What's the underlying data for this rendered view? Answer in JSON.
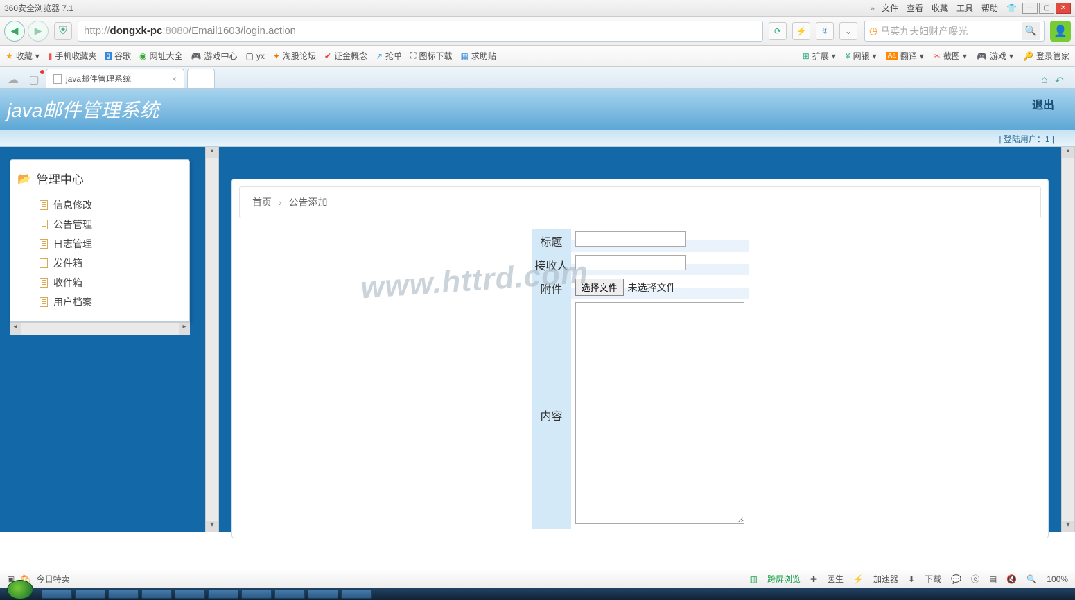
{
  "browser": {
    "title": "360安全浏览器 7.1",
    "menus": [
      "文件",
      "查看",
      "收藏",
      "工具",
      "帮助"
    ],
    "url_proto": "http://",
    "url_host": "dongxk-pc",
    "url_port": ":8080",
    "url_path": "/Email1603/login.action",
    "search_placeholder": "马英九夫妇财产曝光"
  },
  "bookmarks": {
    "fav_label": "收藏",
    "items": [
      "手机收藏夹",
      "谷歌",
      "网址大全",
      "游戏中心",
      "yx",
      "淘股论坛",
      "证金概念",
      "抢单",
      "图标下载",
      "求助贴"
    ],
    "right_items": [
      "扩展",
      "网银",
      "翻译",
      "截图",
      "游戏",
      "登录管家"
    ]
  },
  "tab": {
    "title": "java邮件管理系统"
  },
  "app": {
    "banner_title": "java邮件管理系统",
    "logout": "退出",
    "user_line": "| 登陆用户：1 |"
  },
  "sidebar": {
    "title": "管理中心",
    "items": [
      "信息修改",
      "公告管理",
      "日志管理",
      "发件箱",
      "收件箱",
      "用户档案"
    ]
  },
  "breadcrumb": {
    "home": "首页",
    "current": "公告添加"
  },
  "form": {
    "title_label": "标题",
    "receiver_label": "接收人",
    "attach_label": "附件",
    "file_button": "选择文件",
    "file_status": "未选择文件",
    "content_label": "内容"
  },
  "watermark": "www.httrd.com",
  "statusbar": {
    "left": "今日特卖",
    "items": [
      "跨屏浏览",
      "医生",
      "加速器",
      "下载"
    ],
    "zoom": "100%"
  }
}
